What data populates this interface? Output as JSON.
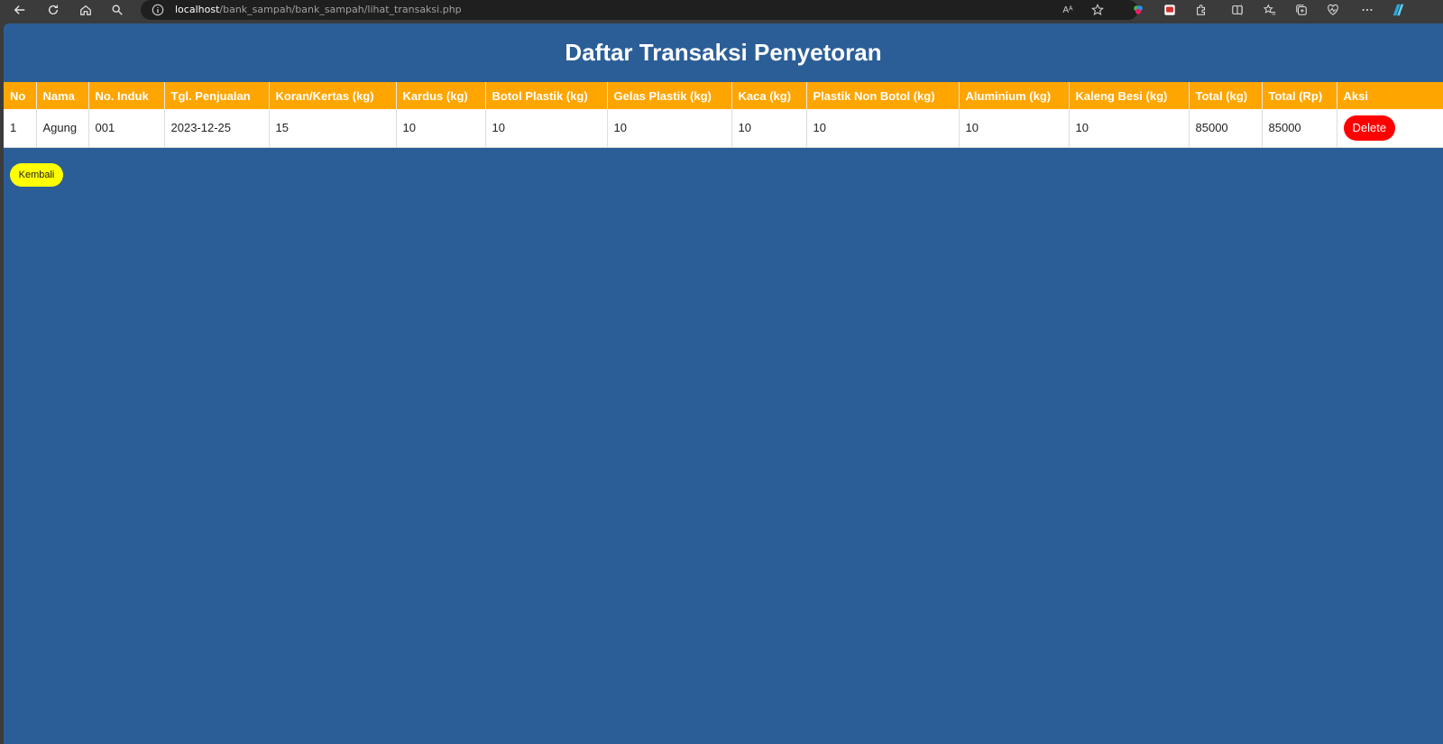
{
  "browser": {
    "url_host": "localhost",
    "url_path": "/bank_sampah/bank_sampah/lihat_transaksi.php",
    "read_aloud_label": "Aᴬ"
  },
  "page": {
    "title": "Daftar Transaksi Penyetoran",
    "back_label": "Kembali"
  },
  "table": {
    "headers": [
      "No",
      "Nama",
      "No. Induk",
      "Tgl. Penjualan",
      "Koran/Kertas (kg)",
      "Kardus (kg)",
      "Botol Plastik (kg)",
      "Gelas Plastik (kg)",
      "Kaca (kg)",
      "Plastik Non Botol (kg)",
      "Aluminium (kg)",
      "Kaleng Besi (kg)",
      "Total (kg)",
      "Total (Rp)",
      "Aksi"
    ],
    "rows": [
      {
        "cells": [
          "1",
          "Agung",
          "001",
          "2023-12-25",
          "15",
          "10",
          "10",
          "10",
          "10",
          "10",
          "10",
          "10",
          "85000",
          "85000"
        ],
        "action_label": "Delete"
      }
    ]
  },
  "colors": {
    "page_bg": "#2b5e97",
    "header_bg": "#ffa500",
    "delete_bg": "#ff0000",
    "back_bg": "#ffff00"
  }
}
